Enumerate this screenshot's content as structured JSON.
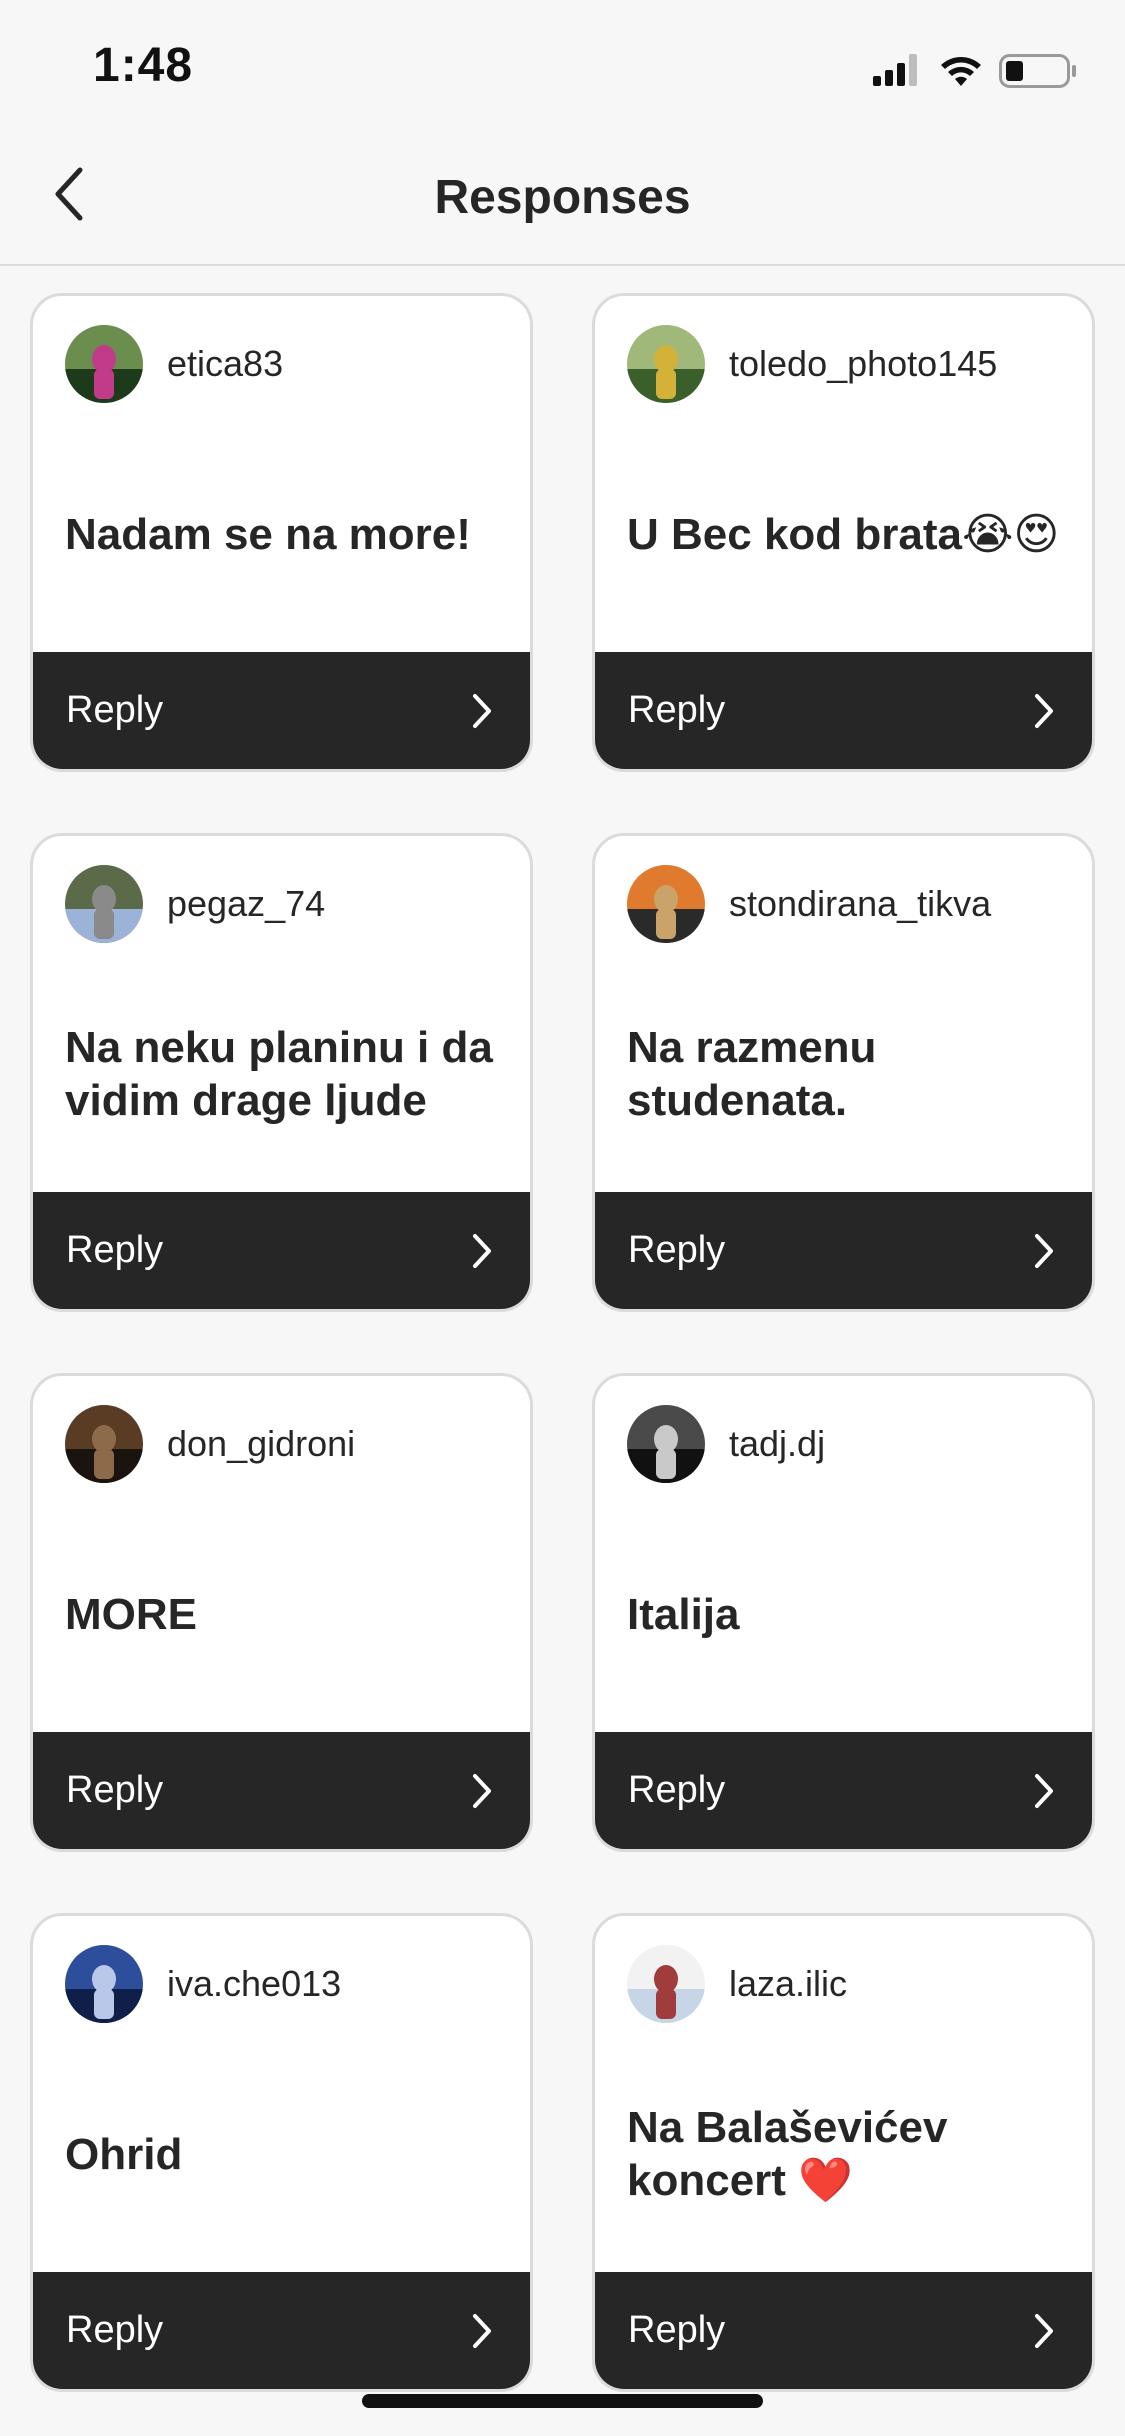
{
  "status_bar": {
    "time": "1:48",
    "icons": [
      "cellular-signal-icon",
      "wifi-icon",
      "battery-icon"
    ]
  },
  "nav": {
    "title": "Responses",
    "back_icon": "chevron-left-icon"
  },
  "reply_label": "Reply",
  "responses": [
    {
      "username": "etica83",
      "text": "Nadam se na more!",
      "avatar_colors": [
        "#1d3a1a",
        "#6b8e4e",
        "#c23b8b"
      ]
    },
    {
      "username": "toledo_photo145",
      "text": "U Bec kod brata😭😍",
      "avatar_colors": [
        "#3b5f2a",
        "#a0b87a",
        "#d4b23a"
      ]
    },
    {
      "username": "pegaz_74",
      "text": "Na neku planinu i da vidim drage ljude",
      "avatar_colors": [
        "#9bb3d6",
        "#5b6b4a",
        "#8a8a8a"
      ]
    },
    {
      "username": "stondirana_tikva",
      "text": "Na razmenu studenata.",
      "avatar_colors": [
        "#2a2a2a",
        "#e07a2e",
        "#c9a36a"
      ]
    },
    {
      "username": "don_gidroni",
      "text": "MORE",
      "avatar_colors": [
        "#1a1410",
        "#5a3b24",
        "#8c6a4a"
      ]
    },
    {
      "username": "tadj.dj",
      "text": "Italija",
      "avatar_colors": [
        "#111111",
        "#4a4a4a",
        "#c9c9c9"
      ]
    },
    {
      "username": "iva.che013",
      "text": "Ohrid",
      "avatar_colors": [
        "#0f1f4a",
        "#2d4e9a",
        "#b9c8e8"
      ]
    },
    {
      "username": "laza.ilic",
      "text": "Na Balaševićev koncert ❤️",
      "avatar_colors": [
        "#c7d6e6",
        "#f2f2f2",
        "#a13c3c"
      ]
    }
  ],
  "colors": {
    "background": "#f7f7f7",
    "card_border": "#dbdbdb",
    "reply_bar": "#262626",
    "text": "#262626"
  }
}
